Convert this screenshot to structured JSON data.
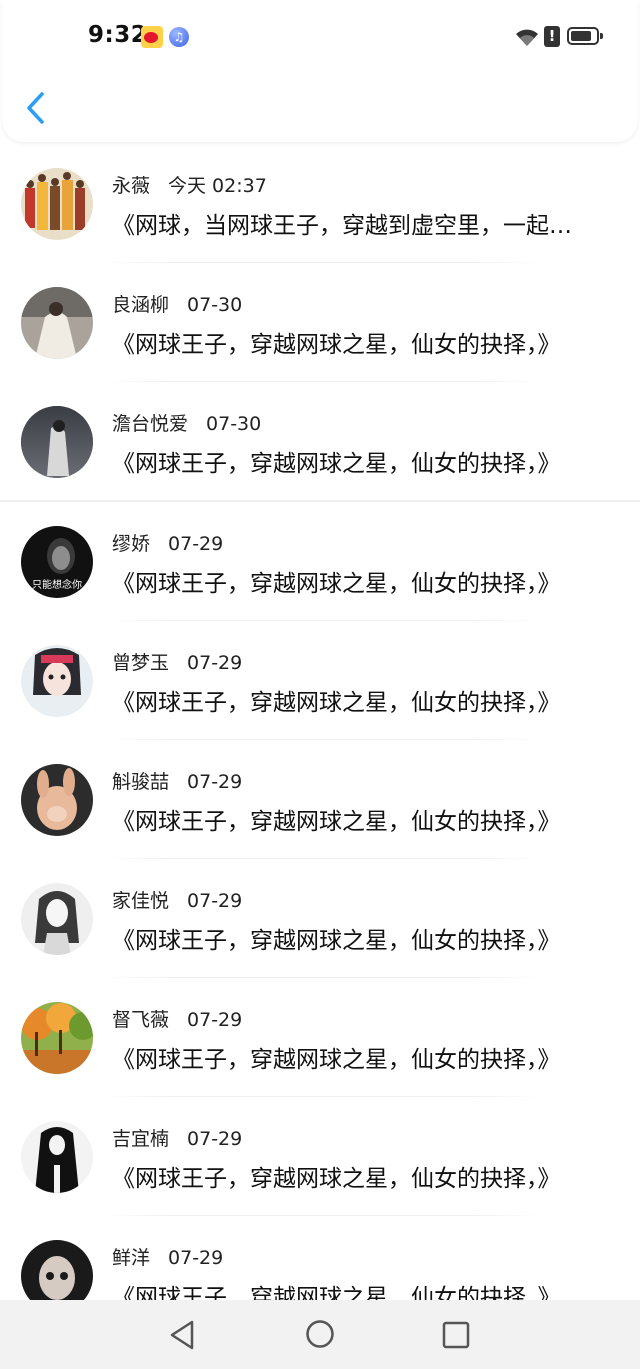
{
  "status_bar": {
    "time": "9:32",
    "icons": [
      "weibo-icon",
      "music-icon",
      "wifi-icon",
      "alert-icon",
      "battery-icon"
    ]
  },
  "header": {
    "back_icon": "chevron-left-icon",
    "accent_color": "#2a9df4"
  },
  "comments": [
    {
      "name": "永薇",
      "date": "今天 02:37",
      "text": "《网球，当网球王子，穿越到虚空里，一起…",
      "avatar": "group-photo-avatar"
    },
    {
      "name": "良涵柳",
      "date": "07-30",
      "text": "《网球王子，穿越网球之星，仙女的抉择，》",
      "avatar": "girl-white-dress-avatar"
    },
    {
      "name": "澹台悦爱",
      "date": "07-30",
      "text": "《网球王子，穿越网球之星，仙女的抉择，》",
      "avatar": "dark-figure-avatar"
    },
    {
      "name": "缪娇",
      "date": "07-29",
      "text": "《网球王子，穿越网球之星，仙女的抉择，》",
      "avatar": "dark-portrait-avatar",
      "avatar_text": "只能想念你"
    },
    {
      "name": "曾梦玉",
      "date": "07-29",
      "text": "《网球王子，穿越网球之星，仙女的抉择，》",
      "avatar": "girl-selfie-avatar"
    },
    {
      "name": "斛骏喆",
      "date": "07-29",
      "text": "《网球王子，穿越网球之星，仙女的抉择，》",
      "avatar": "bunny-avatar"
    },
    {
      "name": "家佳悦",
      "date": "07-29",
      "text": "《网球王子，穿越网球之星，仙女的抉择，》",
      "avatar": "sketch-girl-avatar"
    },
    {
      "name": "督飞薇",
      "date": "07-29",
      "text": "《网球王子，穿越网球之星，仙女的抉择，》",
      "avatar": "autumn-trees-avatar"
    },
    {
      "name": "吉宜楠",
      "date": "07-29",
      "text": "《网球王子，穿越网球之星，仙女的抉择，》",
      "avatar": "bw-figure-avatar"
    },
    {
      "name": "鲜洋",
      "date": "07-29",
      "text": "《网球王子，穿越网球之星，仙女的抉择，》",
      "avatar": "doll-avatar"
    }
  ],
  "nav_bar": {
    "icons": [
      "nav-back-icon",
      "nav-home-icon",
      "nav-recent-icon"
    ]
  }
}
